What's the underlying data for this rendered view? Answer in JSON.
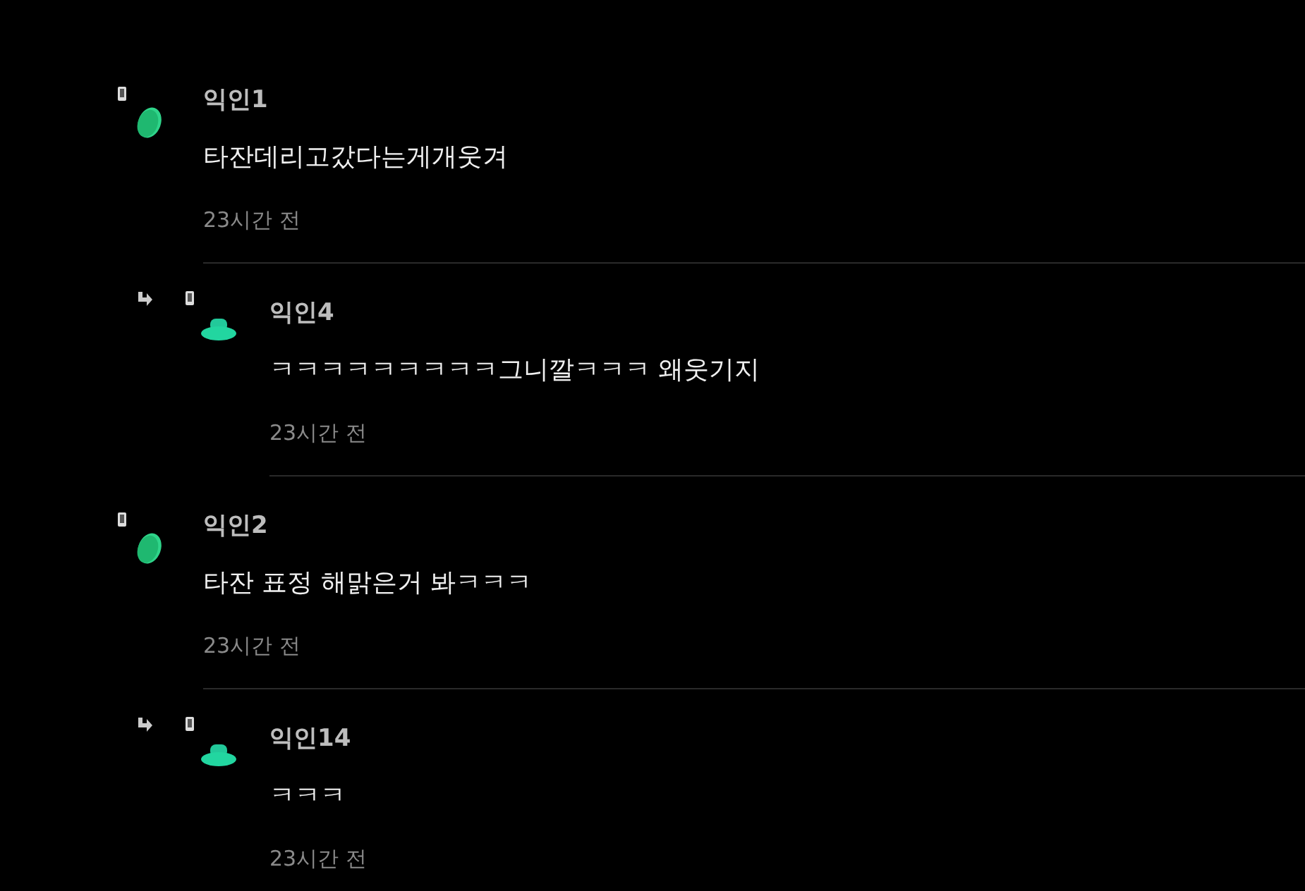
{
  "comments": [
    {
      "kind": "comment",
      "author": "익인1",
      "text": "타잔데리고갔다는게개웃겨",
      "time": "23시간 전"
    },
    {
      "kind": "reply",
      "author": "익인4",
      "text": "ㅋㅋㅋㅋㅋㅋㅋㅋㅋ그니깔ㅋㅋㅋ 왜웃기지",
      "time": "23시간 전"
    },
    {
      "kind": "comment",
      "author": "익인2",
      "text": "타잔 표정 해맑은거 봐ㅋㅋㅋ",
      "time": "23시간 전"
    },
    {
      "kind": "reply",
      "author": "익인14",
      "text": "ㅋㅋㅋ",
      "time": "23시간 전"
    }
  ]
}
